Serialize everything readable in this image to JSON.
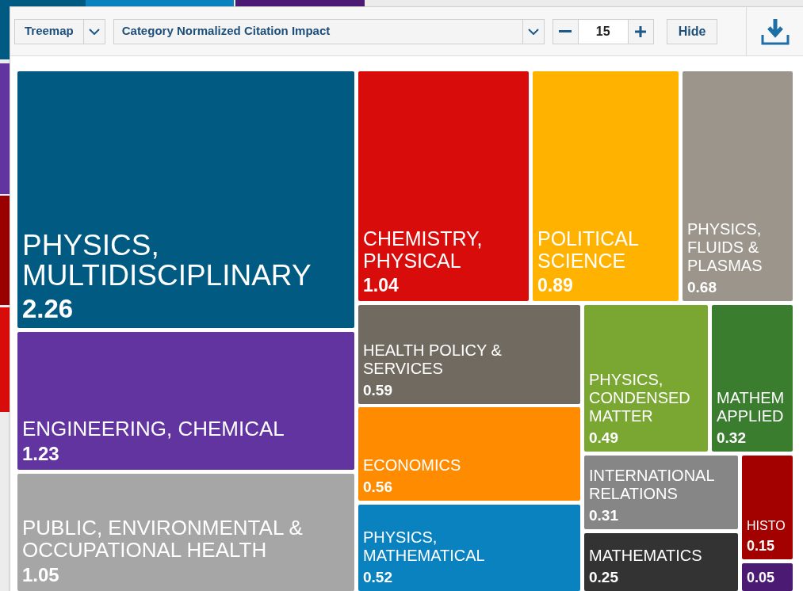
{
  "toolbar": {
    "view_select": "Treemap",
    "metric_select": "Category Normalized Citation Impact",
    "count": "15",
    "hide_button": "Hide"
  },
  "tiles": [
    {
      "label": "PHYSICS,\nMULTIDISCIPLINARY",
      "value": "2.26",
      "color": "#005a82"
    },
    {
      "label": "ENGINEERING, CHEMICAL",
      "value": "1.23",
      "color": "#6234a0"
    },
    {
      "label": "PUBLIC, ENVIRONMENTAL &\nOCCUPATIONAL HEALTH",
      "value": "1.05",
      "color": "#a6a6a6"
    },
    {
      "label": "CHEMISTRY,\nPHYSICAL",
      "value": "1.04",
      "color": "#d90c0c"
    },
    {
      "label": "POLITICAL\nSCIENCE",
      "value": "0.89",
      "color": "#ffb300"
    },
    {
      "label": "PHYSICS,\nFLUIDS &\nPLASMAS",
      "value": "0.68",
      "color": "#9b958c"
    },
    {
      "label": "HEALTH POLICY &\nSERVICES",
      "value": "0.59",
      "color": "#716a60"
    },
    {
      "label": "ECONOMICS",
      "value": "0.56",
      "color": "#ff8c00"
    },
    {
      "label": "PHYSICS,\nMATHEMATICAL",
      "value": "0.52",
      "color": "#0a82c0"
    },
    {
      "label": "PHYSICS,\nCONDENSED\nMATTER",
      "value": "0.49",
      "color": "#7aa632"
    },
    {
      "label": "MATHEM\nAPPLIED",
      "value": "0.32",
      "color": "#3a7d2e"
    },
    {
      "label": "INTERNATIONAL\nRELATIONS",
      "value": "0.31",
      "color": "#868686"
    },
    {
      "label": "MATHEMATICS",
      "value": "0.25",
      "color": "#333333"
    },
    {
      "label": "HISTO",
      "value": "0.15",
      "color": "#a30000"
    },
    {
      "value": "0.05",
      "color": "#4b1a73"
    }
  ]
}
